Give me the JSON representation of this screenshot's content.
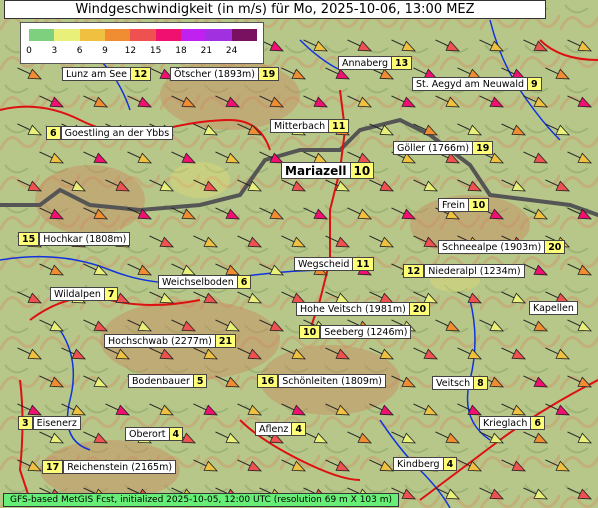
{
  "title": "Windgeschwindigkeit (in m/s) für Mo, 2025-10-06, 13:00 MEZ",
  "legend": {
    "ticks": [
      "0",
      "3",
      "6",
      "9",
      "12",
      "15",
      "18",
      "21",
      "24"
    ],
    "colors": [
      "#7ecf7e",
      "#e9f07a",
      "#f0c040",
      "#f08c32",
      "#ef5050",
      "#ef1070",
      "#c020f0",
      "#a030e0",
      "#7a1060"
    ]
  },
  "places": [
    {
      "name": "Lunz am See",
      "value": "12"
    },
    {
      "name": "Ötscher (1893m)",
      "value": "19"
    },
    {
      "name": "Annaberg",
      "value": "13"
    },
    {
      "name": "St. Aegyd am Neuwald",
      "value": "9"
    },
    {
      "name": "Goestling an der Ybbs",
      "value": "6"
    },
    {
      "name": "Mitterbach",
      "value": "11"
    },
    {
      "name": "Göller (1766m)",
      "value": "19"
    },
    {
      "name": "Mariazell",
      "value": "10"
    },
    {
      "name": "Frein",
      "value": "10"
    },
    {
      "name": "Hochkar (1808m)",
      "value": "15"
    },
    {
      "name": "Schneealpe (1903m)",
      "value": "20"
    },
    {
      "name": "Wegscheid",
      "value": "11"
    },
    {
      "name": "Niederalpl (1234m)",
      "value": "12"
    },
    {
      "name": "Weichselboden",
      "value": "6"
    },
    {
      "name": "Wildalpen",
      "value": "7"
    },
    {
      "name": "Hohe Veitsch (1981m)",
      "value": "20"
    },
    {
      "name": "Kapellen",
      "value": ""
    },
    {
      "name": "Seeberg (1246m)",
      "value": "10"
    },
    {
      "name": "Hochschwab (2277m)",
      "value": "21"
    },
    {
      "name": "Bodenbauer",
      "value": "5"
    },
    {
      "name": "Schönleiten (1809m)",
      "value": "16"
    },
    {
      "name": "Veitsch",
      "value": "8"
    },
    {
      "name": "Eisenerz",
      "value": "3"
    },
    {
      "name": "Oberort",
      "value": "4"
    },
    {
      "name": "Aflenz",
      "value": "4"
    },
    {
      "name": "Krieglach",
      "value": "6"
    },
    {
      "name": "Reichenstein (2165m)",
      "value": "17"
    },
    {
      "name": "Kindberg",
      "value": "4"
    }
  ],
  "footer": "GFS-based MetGIS Fcst, initialized 2025-10-05, 12:00 UTC  (resolution 69 m X 103 m)"
}
